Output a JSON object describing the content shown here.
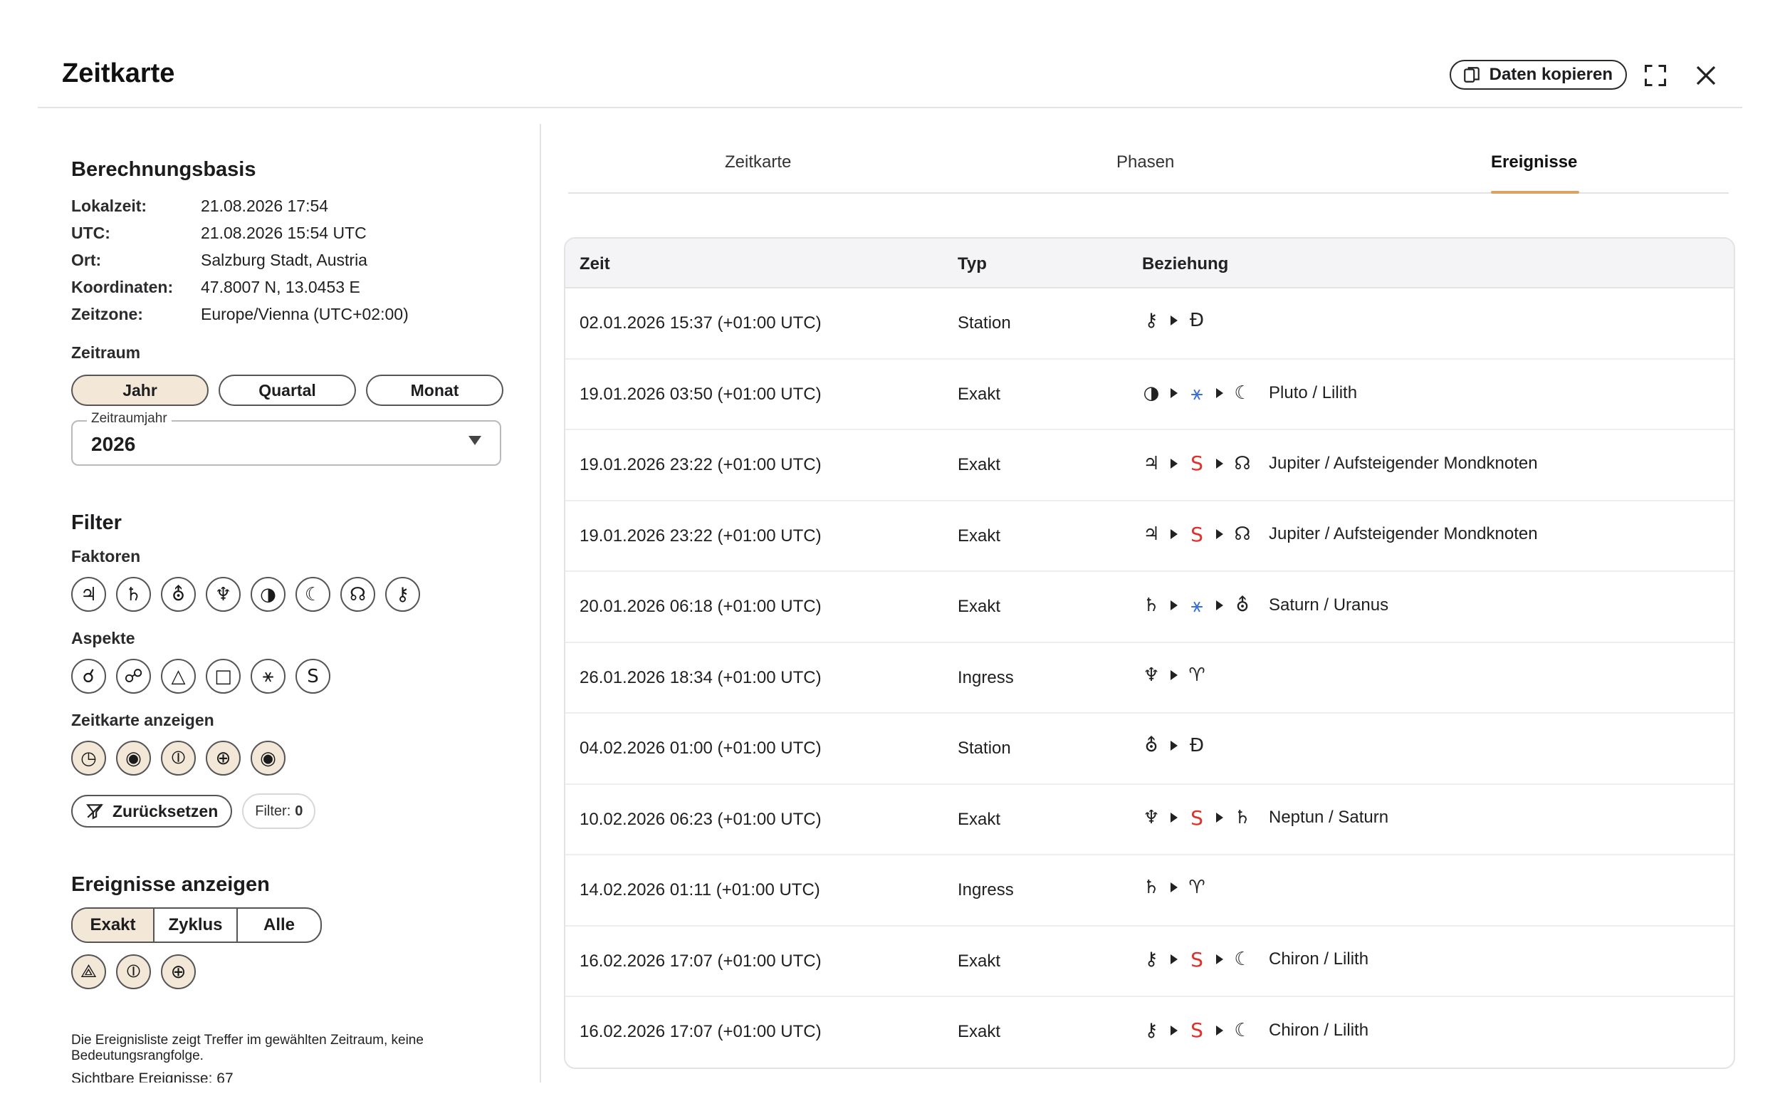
{
  "window": {
    "title": "Zeitkarte",
    "copy_label": "Daten kopieren"
  },
  "basis": {
    "title": "Berechnungsbasis",
    "rows": [
      {
        "k": "Lokalzeit:",
        "v": "21.08.2026 17:54"
      },
      {
        "k": "UTC:",
        "v": "21.08.2026 15:54 UTC"
      },
      {
        "k": "Ort:",
        "v": "Salzburg Stadt, Austria"
      },
      {
        "k": "Koordinaten:",
        "v": "47.8007 N, 13.0453 E"
      },
      {
        "k": "Zeitzone:",
        "v": "Europe/Vienna (UTC+02:00)"
      }
    ]
  },
  "zeitraum": {
    "title": "Zeitraum",
    "options": [
      "Jahr",
      "Quartal",
      "Monat"
    ],
    "select_legend": "Zeitraumjahr",
    "select_value": "2026"
  },
  "filter": {
    "title": "Filter",
    "faktoren_title": "Faktoren",
    "faktoren": [
      "♃",
      "♄",
      "⛢",
      "♆",
      "◑",
      "☾",
      "☊",
      "⚷"
    ],
    "aspekte_title": "Aspekte",
    "aspekte": [
      "☌",
      "☍",
      "△",
      "□",
      "⚹",
      "S"
    ],
    "zeitkarte_title": "Zeitkarte anzeigen",
    "zeitkarte": [
      "◷",
      "◉",
      "⦶",
      "⊕",
      "◉"
    ],
    "reset_label": "Zurücksetzen",
    "count_label": "Filter:",
    "count_value": "0"
  },
  "ereignisse": {
    "title": "Ereignisse anzeigen",
    "options": [
      "Exakt",
      "Zyklus",
      "Alle"
    ],
    "icons": [
      "⟁",
      "⦶",
      "⊕"
    ],
    "note": "Die Ereignisliste zeigt Treffer im gewählten Zeitraum, keine Bedeutungsrangfolge.",
    "visible_count": "Sichtbare Ereignisse: 67"
  },
  "tabs": [
    "Zeitkarte",
    "Phasen",
    "Ereignisse"
  ],
  "table": {
    "headers": [
      "Zeit",
      "Typ",
      "Beziehung"
    ],
    "rows": [
      {
        "zeit": "02.01.2026 15:37 (+01:00 UTC)",
        "typ": "Station",
        "a": "⚷",
        "asp": "",
        "b": "Đ",
        "desc": ""
      },
      {
        "zeit": "19.01.2026 03:50 (+01:00 UTC)",
        "typ": "Exakt",
        "a": "◑",
        "asp": "⚹",
        "b": "☾",
        "desc": "Pluto / Lilith"
      },
      {
        "zeit": "19.01.2026 23:22 (+01:00 UTC)",
        "typ": "Exakt",
        "a": "♃",
        "asp": "S",
        "b": "☊",
        "desc": "Jupiter / Aufsteigender Mondknoten"
      },
      {
        "zeit": "19.01.2026 23:22 (+01:00 UTC)",
        "typ": "Exakt",
        "a": "♃",
        "asp": "S",
        "b": "☊",
        "desc": "Jupiter / Aufsteigender Mondknoten"
      },
      {
        "zeit": "20.01.2026 06:18 (+01:00 UTC)",
        "typ": "Exakt",
        "a": "♄",
        "asp": "⚹",
        "b": "⛢",
        "desc": "Saturn / Uranus"
      },
      {
        "zeit": "26.01.2026 18:34 (+01:00 UTC)",
        "typ": "Ingress",
        "a": "♆",
        "asp": "",
        "b": "♈",
        "desc": ""
      },
      {
        "zeit": "04.02.2026 01:00 (+01:00 UTC)",
        "typ": "Station",
        "a": "⛢",
        "asp": "",
        "b": "Đ",
        "desc": ""
      },
      {
        "zeit": "10.02.2026 06:23 (+01:00 UTC)",
        "typ": "Exakt",
        "a": "♆",
        "asp": "S",
        "b": "♄",
        "desc": "Neptun / Saturn"
      },
      {
        "zeit": "14.02.2026 01:11 (+01:00 UTC)",
        "typ": "Ingress",
        "a": "♄",
        "asp": "",
        "b": "♈",
        "desc": ""
      },
      {
        "zeit": "16.02.2026 17:07 (+01:00 UTC)",
        "typ": "Exakt",
        "a": "⚷",
        "asp": "S",
        "b": "☾",
        "desc": "Chiron / Lilith"
      },
      {
        "zeit": "16.02.2026 17:07 (+01:00 UTC)",
        "typ": "Exakt",
        "a": "⚷",
        "asp": "S",
        "b": "☾",
        "desc": "Chiron / Lilith"
      }
    ]
  },
  "colors": {
    "accent": "#d9a463",
    "active_bg": "#f3e8d8",
    "aspect_red": "#e0302a",
    "aspect_blue": "#3b6fe0"
  }
}
